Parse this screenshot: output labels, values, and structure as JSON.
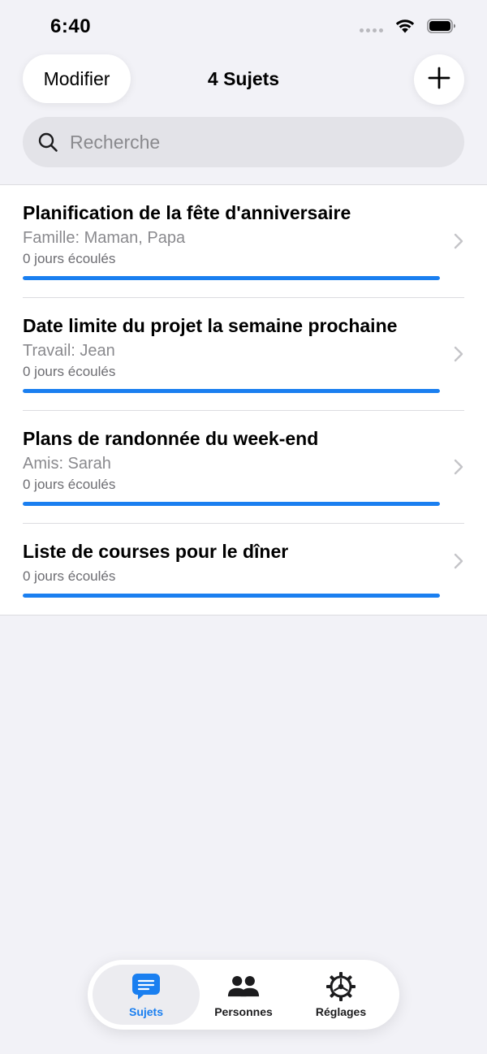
{
  "status_bar": {
    "time": "6:40"
  },
  "header": {
    "edit_label": "Modifier",
    "title": "4 Sujets",
    "add_icon": "plus-icon"
  },
  "search": {
    "placeholder": "Recherche",
    "value": ""
  },
  "topics": [
    {
      "title": "Planification de la fête d'anniversaire",
      "subtitle": "Famille: Maman, Papa",
      "elapsed": "0 jours écoulés",
      "progress": 1.0
    },
    {
      "title": "Date limite du projet la semaine prochaine",
      "subtitle": "Travail: Jean",
      "elapsed": "0 jours écoulés",
      "progress": 1.0
    },
    {
      "title": "Plans de randonnée du week-end",
      "subtitle": "Amis: Sarah",
      "elapsed": "0 jours écoulés",
      "progress": 1.0
    },
    {
      "title": "Liste de courses pour le dîner",
      "subtitle": "",
      "elapsed": "0 jours écoulés",
      "progress": 1.0
    }
  ],
  "tab_bar": {
    "tabs": [
      {
        "label": "Sujets",
        "icon": "message-icon",
        "active": true
      },
      {
        "label": "Personnes",
        "icon": "people-icon",
        "active": false
      },
      {
        "label": "Réglages",
        "icon": "gear-icon",
        "active": false
      }
    ]
  },
  "colors": {
    "accent": "#1a7ff0",
    "background": "#f2f2f7",
    "secondary_text": "#8a8a8e"
  }
}
